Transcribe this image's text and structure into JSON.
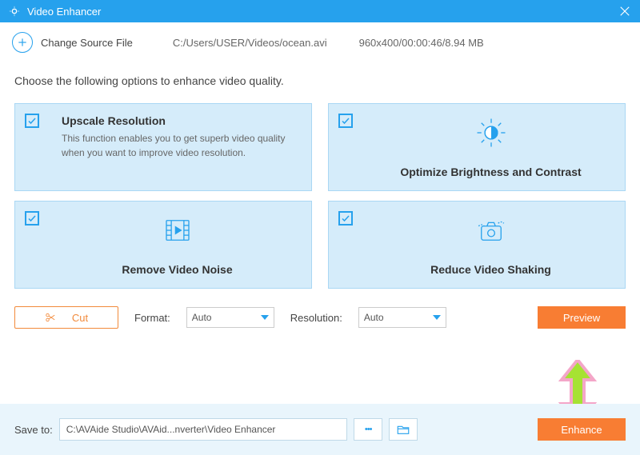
{
  "titlebar": {
    "title": "Video Enhancer"
  },
  "sourcebar": {
    "change_label": "Change Source File",
    "filepath": "C:/Users/USER/Videos/ocean.avi",
    "fileinfo": "960x400/00:00:46/8.94 MB"
  },
  "instruction": "Choose the following options to enhance video quality.",
  "options": {
    "upscale": {
      "title": "Upscale Resolution",
      "desc": "This function enables you to get superb video quality when you want to improve video resolution."
    },
    "brightness": {
      "title": "Optimize Brightness and Contrast"
    },
    "noise": {
      "title": "Remove Video Noise"
    },
    "shaking": {
      "title": "Reduce Video Shaking"
    }
  },
  "controls": {
    "cut_label": "Cut",
    "format_label": "Format:",
    "format_value": "Auto",
    "resolution_label": "Resolution:",
    "resolution_value": "Auto",
    "preview_label": "Preview"
  },
  "footer": {
    "save_label": "Save to:",
    "path": "C:\\AVAide Studio\\AVAid...nverter\\Video Enhancer",
    "dots": "• • •",
    "enhance_label": "Enhance"
  }
}
